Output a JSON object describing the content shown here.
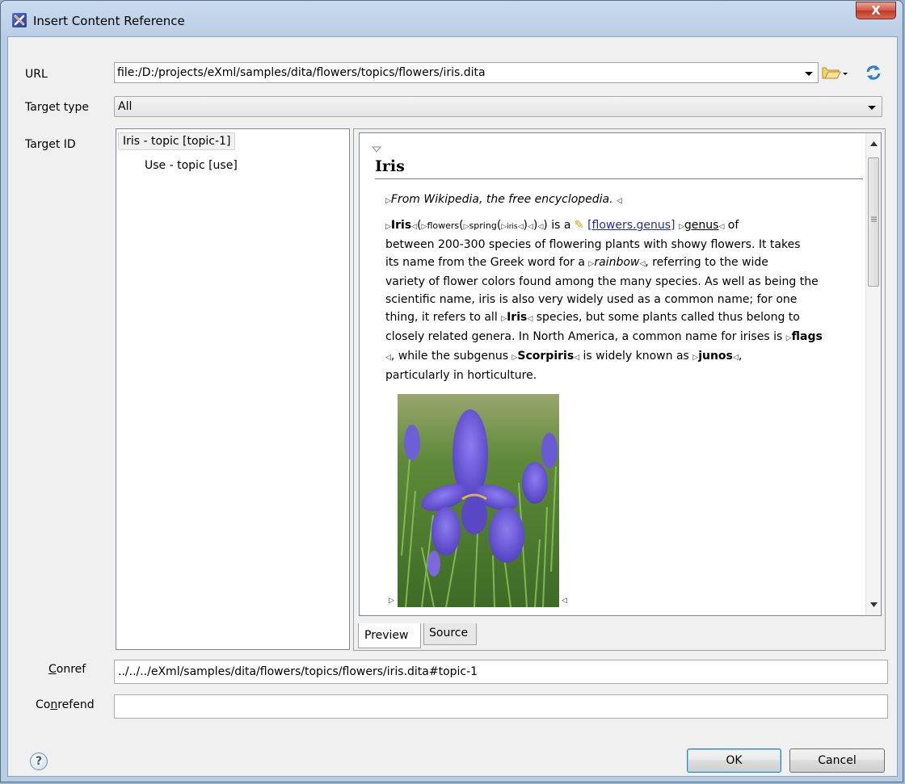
{
  "window": {
    "title": "Insert Content Reference",
    "close_glyph": "X"
  },
  "form": {
    "url_label": "URL",
    "url_value": "file:/D:/projects/eXml/samples/dita/flowers/topics/flowers/iris.dita",
    "target_type_label": "Target type",
    "target_type_value": "All",
    "target_id_label": "Target ID",
    "conref_label": "Conref",
    "conref_value": "../../../eXml/samples/dita/flowers/topics/flowers/iris.dita#topic-1",
    "conrefend_label": "Conrefend",
    "conrefend_value": ""
  },
  "tree": {
    "items": [
      {
        "label": "Iris - topic [topic-1]"
      },
      {
        "label": "Use - topic [use]"
      }
    ]
  },
  "preview": {
    "heading": "Iris",
    "shortdesc": "From Wikipedia, the free encyclopedia.",
    "p_iris": "Iris",
    "p_flowers": "flowers",
    "p_spring": "spring",
    "p_iris_small": "iris",
    "p_is_a": ") is a",
    "p_keyref": "[flowers.genus]",
    "p_genus": "genus",
    "p_of": "of",
    "l2": "between 200-300 species of flowering plants with showy flowers. It takes",
    "l3a": "its name from the Greek word for a",
    "l3_rainbow": "rainbow",
    "l3b": ", referring to the wide",
    "l4": "variety of flower colors found among the many species. As well as being the",
    "l5": "scientific name, iris is also very widely used as a common name; for one",
    "l6a": "thing, it refers to all",
    "l6_iris": "Iris",
    "l6b": "species, but some plants called thus belong to",
    "l7a": "closely related genera. In North America, a common name for irises is",
    "l7_flags": "flags",
    "l8a": ", while the subgenus",
    "l8_scorpiris": "Scorpiris",
    "l8b": "is widely known as",
    "l8_junos": "junos",
    "l8c": ",",
    "l9": "particularly in horticulture."
  },
  "tabs": [
    {
      "label": "Preview",
      "selected": true
    },
    {
      "label": "Source",
      "selected": false
    }
  ],
  "buttons": {
    "ok": "OK",
    "cancel": "Cancel",
    "help": "?"
  },
  "icons": {
    "app": "oxygen-x-icon",
    "open": "folder-open-icon",
    "reload": "reload-icon",
    "help": "help-icon"
  },
  "colors": {
    "link": "#1f2fa6",
    "titlebar": "#c9dbee",
    "client": "#f0f0f0"
  }
}
